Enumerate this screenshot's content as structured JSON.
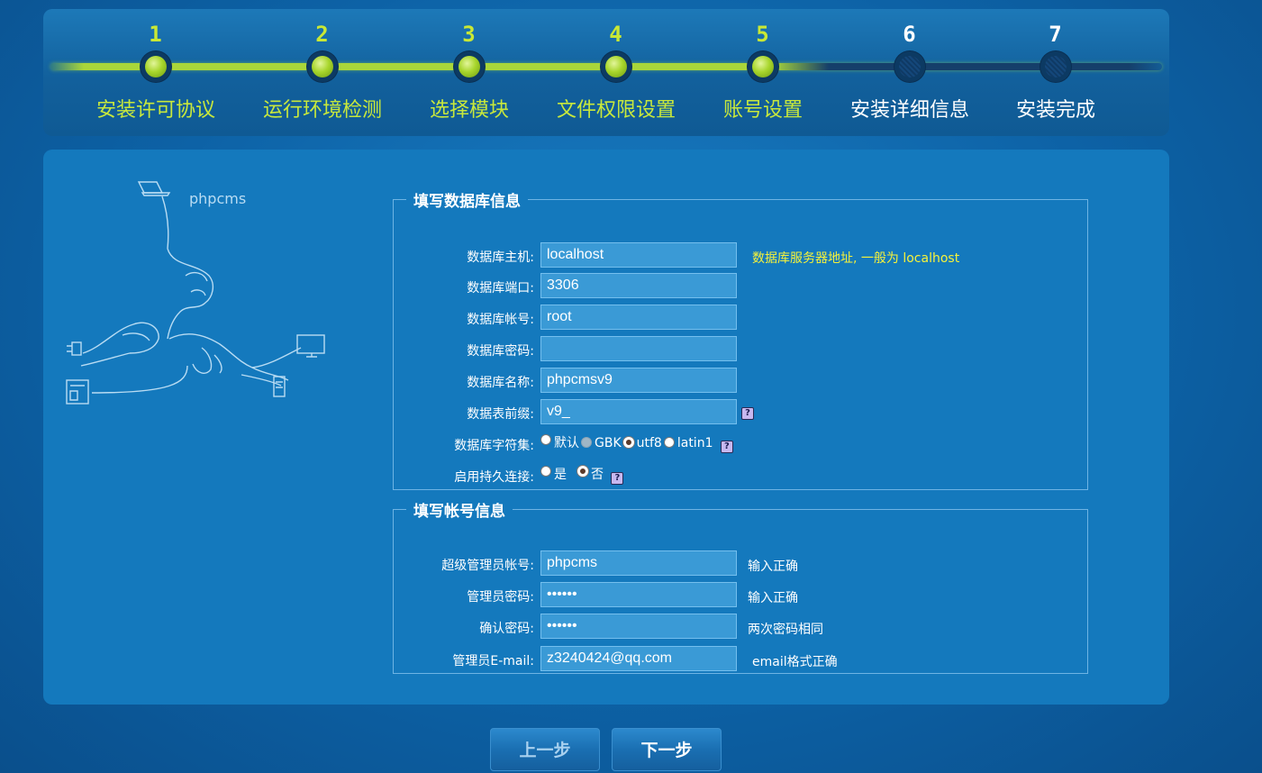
{
  "steps": [
    {
      "num": "1",
      "label": "安装许可协议"
    },
    {
      "num": "2",
      "label": "运行环境检测"
    },
    {
      "num": "3",
      "label": "选择模块"
    },
    {
      "num": "4",
      "label": "文件权限设置"
    },
    {
      "num": "5",
      "label": "账号设置"
    },
    {
      "num": "6",
      "label": "安装详细信息"
    },
    {
      "num": "7",
      "label": "安装完成"
    }
  ],
  "illustration": {
    "brand": "phpcms"
  },
  "db": {
    "legend": "填写数据库信息",
    "host_label": "数据库主机:",
    "host_value": "localhost",
    "host_hint": "数据库服务器地址, 一般为 localhost",
    "port_label": "数据库端口:",
    "port_value": "3306",
    "user_label": "数据库帐号:",
    "user_value": "root",
    "password_label": "数据库密码:",
    "password_value": "",
    "name_label": "数据库名称:",
    "name_value": "phpcmsv9",
    "prefix_label": "数据表前缀:",
    "prefix_value": "v9_",
    "charset_label": "数据库字符集:",
    "charset_options": [
      "默认",
      "GBK",
      "utf8",
      "latin1"
    ],
    "persistent_label": "启用持久连接:",
    "persistent_options": [
      "是",
      "否"
    ],
    "help_glyph": "?"
  },
  "account": {
    "legend": "填写帐号信息",
    "admin_label": "超级管理员帐号:",
    "admin_value": "phpcms",
    "admin_hint": "输入正确",
    "password_label": "管理员密码:",
    "password_value": "••••••",
    "password_hint": "输入正确",
    "confirm_label": "确认密码:",
    "confirm_value": "••••••",
    "confirm_hint": "两次密码相同",
    "email_label": "管理员E-mail:",
    "email_value": "z3240424@qq.com",
    "email_hint": "email格式正确"
  },
  "buttons": {
    "prev": "上一步",
    "next": "下一步"
  },
  "colors": {
    "accent_green": "#c8e83c",
    "hint_yellow": "#f6f23a",
    "panel": "#1479bd"
  }
}
